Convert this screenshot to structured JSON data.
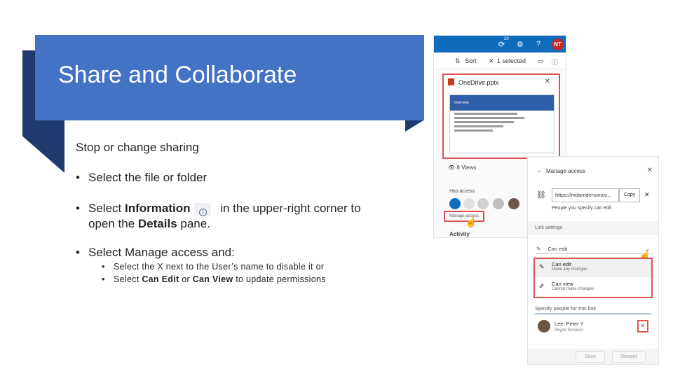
{
  "slide": {
    "title": "Share and Collaborate",
    "subheading": "Stop or change sharing",
    "bullets": [
      "Select the file or folder",
      "Select Manage access and:"
    ],
    "bullet2": {
      "pre": "Select ",
      "bold1": "Information",
      "mid": " in the upper-right corner to",
      "line2_pre": "open the ",
      "bold2": "Details",
      "line2_post": " pane."
    },
    "sub_bullets": {
      "one": "Select the X next to the User’s name to disable it or",
      "two_pre": "Select ",
      "two_b1": "Can Edit",
      "two_mid": " or ",
      "two_b2": "Can View",
      "two_post": " to update permissions"
    },
    "bullet_glyph": "•"
  },
  "onedrive": {
    "avatar": "NT",
    "badge": "20",
    "sort": "Sort",
    "selected": "1 selected",
    "file_name": "OneDrive.pptx",
    "thumb_title": "Overview",
    "views": "8 Views",
    "has_access": "Has access",
    "manage_access": "Manage access",
    "activity": "Activity"
  },
  "manage": {
    "title": "Manage access",
    "link": "https://mdamdersonco...",
    "copy": "Copy",
    "people_note": "People you specify can edit",
    "link_settings": "Link settings",
    "can_edit": "Can edit",
    "options": [
      {
        "label": "Can edit",
        "sub": "Make any changes"
      },
      {
        "label": "Can view",
        "sub": "Cannot make changes"
      }
    ],
    "specify": "Specify people for this link",
    "person_name": "Lee, Peter Y",
    "person_sub": "Skype Services",
    "save": "Save",
    "discard": "Discard"
  },
  "colors": {
    "banner": "#4472c4",
    "banner_shadow": "#1f3a6e",
    "highlight": "#d9534f",
    "onedrive_blue": "#0f6cbd"
  }
}
